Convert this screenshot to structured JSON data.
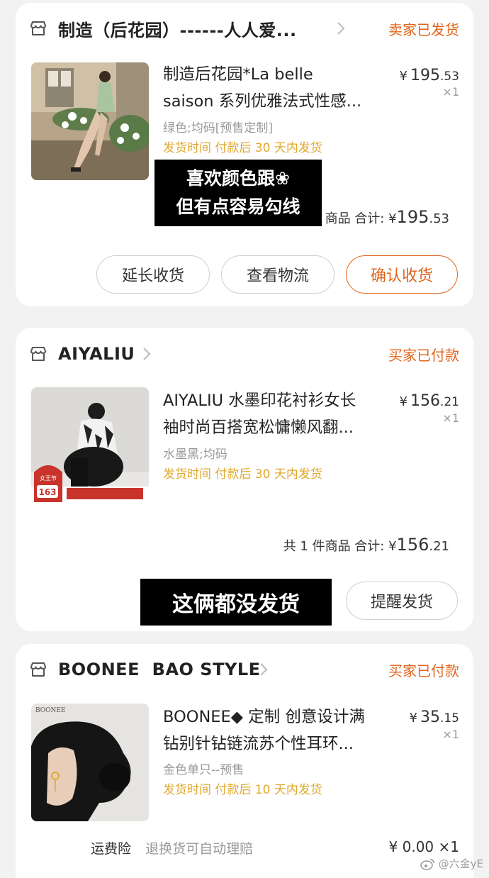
{
  "orders": [
    {
      "shop_name": "制造（后花园）------人人爱...",
      "status": "卖家已发货",
      "product_title_line1": "制造后花园*La belle",
      "product_title_line2": "saison 系列优雅法式性感...",
      "price_int": "195",
      "price_dec": ".53",
      "qty": "×1",
      "spec": "绿色;均码[预售定制]",
      "shipping": "发货时间  付款后 30 天内发货",
      "total_prefix": "商品  合计: ¥",
      "total_int": "195",
      "total_dec": ".53",
      "buttons": [
        "延长收货",
        "查看物流",
        "确认收货"
      ],
      "overlay_line1": "喜欢颜色跟❀",
      "overlay_line2": "但有点容易勾线"
    },
    {
      "shop_name": "AIYALIU",
      "status": "买家已付款",
      "product_title_line1": "AIYALIU 水墨印花衬衫女长",
      "product_title_line2": "袖时尚百搭宽松慵懒风翻...",
      "price_int": "156",
      "price_dec": ".21",
      "qty": "×1",
      "spec": "水墨黑;均码",
      "shipping": "发货时间  付款后 30 天内发货",
      "thumb_badge_title": "女王节",
      "thumb_badge_num": "163",
      "total_prefix": "共 1 件商品  合计: ¥",
      "total_int": "156",
      "total_dec": ".21",
      "buttons": [
        "提醒发货"
      ],
      "overlay_line1": "这俩都没发货"
    },
    {
      "shop_name": "BOONEE  BAO STYLE",
      "status": "买家已付款",
      "product_title_line1": "BOONEE◆ 定制 创意设计满",
      "product_title_line2": "钻别针钻链流苏个性耳环...",
      "price_int": "35",
      "price_dec": ".15",
      "qty": "×1",
      "spec": "金色单只--预售",
      "shipping": "发货时间  付款后 10 天内发货",
      "thumb_brand": "BOONEE",
      "insurance_label": "运费险",
      "insurance_desc": "退换货可自动理赔",
      "insurance_price": "¥ 0.00 ×1"
    }
  ],
  "watermark": "@六金yE",
  "colors": {
    "accent": "#e0651c",
    "shipping": "#e0a82e"
  }
}
